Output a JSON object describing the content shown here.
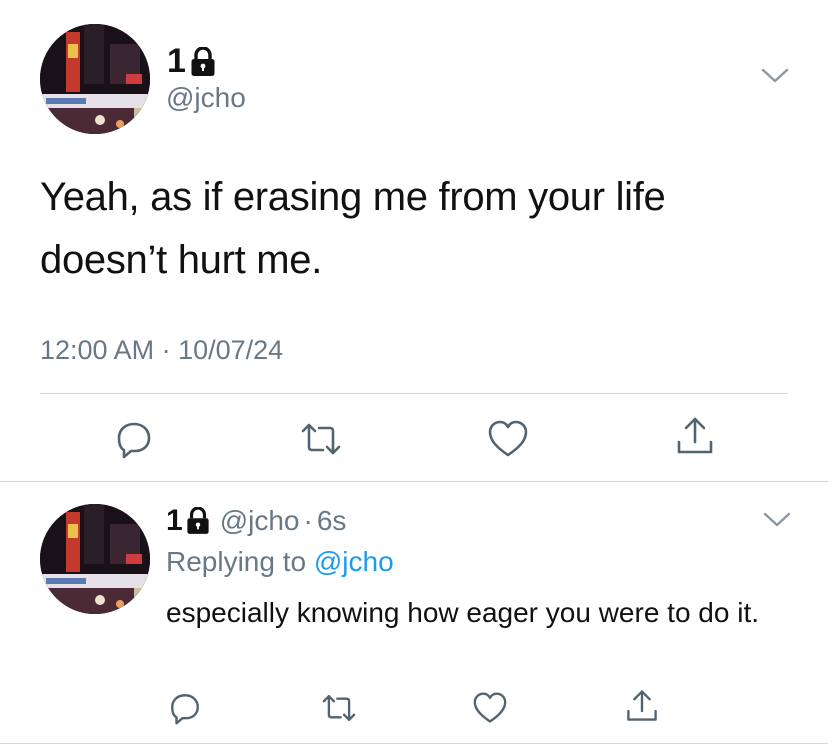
{
  "main_tweet": {
    "display_name": "1",
    "handle": "@jcho",
    "text": "Yeah, as if erasing me from your life doesn’t hurt me.",
    "timestamp": "12:00 AM · 10/07/24",
    "actions": [
      "reply-icon",
      "retweet-icon",
      "like-icon",
      "share-icon"
    ]
  },
  "reply": {
    "display_name": "1",
    "handle": "@jcho",
    "separator": "·",
    "age": "6s",
    "replying_prefix": "Replying to",
    "replying_handle": "@jcho",
    "text": "especially knowing how eager you were to do it.",
    "actions": [
      "reply-icon",
      "retweet-icon",
      "like-icon",
      "share-icon"
    ]
  },
  "colors": {
    "text": "#111111",
    "muted": "#697887",
    "link": "#1d9bf0",
    "divider": "#cfd9de"
  }
}
